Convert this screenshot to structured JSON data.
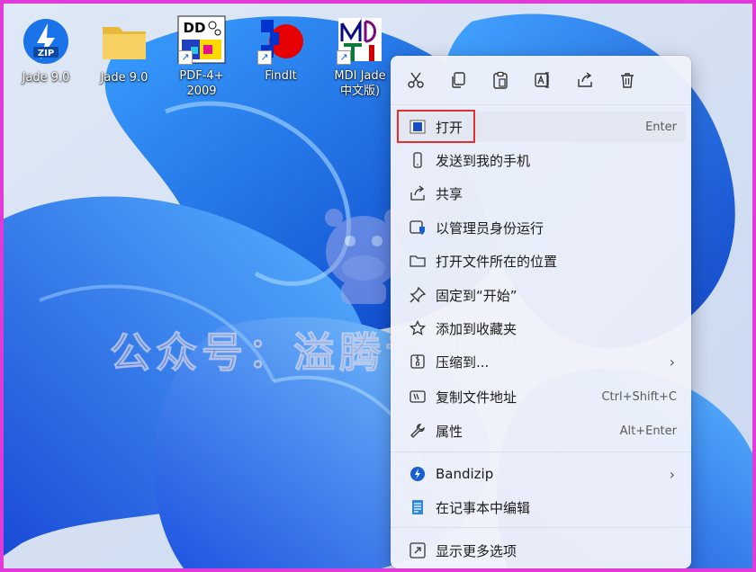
{
  "desktop": {
    "icons": [
      {
        "label": "Jade 9.0",
        "icon": "zip-archive-icon",
        "badge": "ZIP"
      },
      {
        "label": "Jade 9.0",
        "icon": "folder-icon"
      },
      {
        "label": "PDF-4+ 2009",
        "label_line1": "PDF-4+",
        "label_line2": "2009",
        "icon": "pdf4-app-icon",
        "badge": "DD"
      },
      {
        "label": "FindIt",
        "icon": "findit-app-icon"
      },
      {
        "label": "MDI Jade 中文版)",
        "label_line1": "MDI Jade",
        "label_line2": "中文版)",
        "icon": "mdi-jade-icon"
      }
    ]
  },
  "watermark": {
    "text": "公众号：溢腾专业软件"
  },
  "context_menu": {
    "toolbar": [
      {
        "name": "cut",
        "icon": "scissors-icon"
      },
      {
        "name": "copy",
        "icon": "copy-icon"
      },
      {
        "name": "paste",
        "icon": "clipboard-icon"
      },
      {
        "name": "rename",
        "icon": "rename-icon"
      },
      {
        "name": "share",
        "icon": "share-icon"
      },
      {
        "name": "delete",
        "icon": "trash-icon"
      }
    ],
    "items": [
      {
        "label": "打开",
        "shortcut": "Enter",
        "icon": "open-icon"
      },
      {
        "label": "发送到我的手机",
        "shortcut": "",
        "icon": "phone-icon"
      },
      {
        "label": "共享",
        "shortcut": "",
        "icon": "share-icon"
      },
      {
        "label": "以管理员身份运行",
        "shortcut": "",
        "icon": "shield-admin-icon"
      },
      {
        "label": "打开文件所在的位置",
        "shortcut": "",
        "icon": "folder-outline-icon"
      },
      {
        "label": "固定到“开始”",
        "shortcut": "",
        "icon": "pin-icon"
      },
      {
        "label": "添加到收藏夹",
        "shortcut": "",
        "icon": "star-icon"
      },
      {
        "label": "压缩到...",
        "shortcut": "",
        "icon": "archive-icon",
        "submenu": true
      },
      {
        "label": "复制文件地址",
        "shortcut": "Ctrl+Shift+C",
        "icon": "copy-path-icon"
      },
      {
        "label": "属性",
        "shortcut": "Alt+Enter",
        "icon": "wrench-icon"
      },
      {
        "label": "Bandizip",
        "shortcut": "",
        "icon": "bandizip-icon",
        "submenu": true
      },
      {
        "label": "在记事本中编辑",
        "shortcut": "",
        "icon": "notepad-icon"
      },
      {
        "label": "显示更多选项",
        "shortcut": "",
        "icon": "more-options-icon"
      }
    ],
    "submenu_arrow": "›"
  },
  "colors": {
    "highlight_border": "#e03030",
    "frame_border": "#e13ad8",
    "accent": "#1a73e8"
  }
}
